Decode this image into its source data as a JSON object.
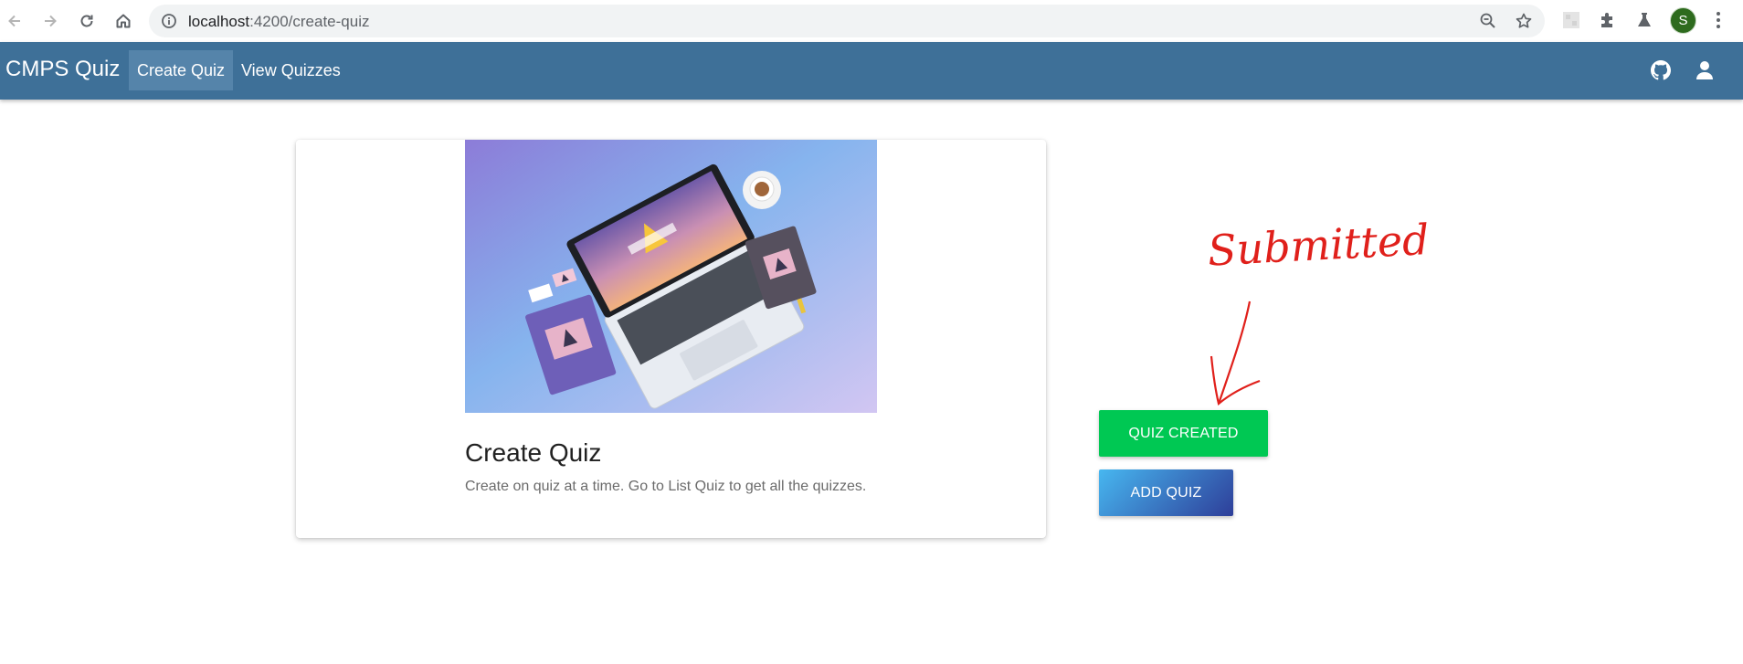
{
  "browser": {
    "url_host": "localhost",
    "url_path": ":4200/create-quiz",
    "profile_initial": "S"
  },
  "navbar": {
    "brand": "CMPS Quiz",
    "links": [
      {
        "label": "Create Quiz",
        "active": true
      },
      {
        "label": "View Quizzes",
        "active": false
      }
    ]
  },
  "card": {
    "title": "Create Quiz",
    "description": "Create on quiz at a time. Go to List Quiz to get all the quizzes."
  },
  "buttons": {
    "quiz_created": "QUIZ CREATED",
    "add_quiz": "ADD QUIZ"
  },
  "annotation": {
    "handwritten_text": "Submitted",
    "color": "#e0201b"
  },
  "colors": {
    "navbar": "#3e7098",
    "success": "#00c853"
  }
}
